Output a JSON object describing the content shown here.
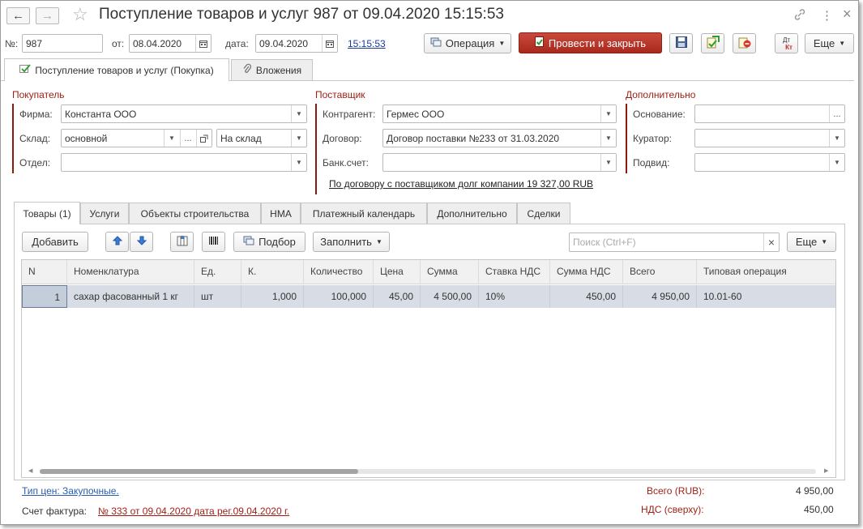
{
  "window": {
    "title": "Поступление товаров и услуг 987 от 09.04.2020 15:15:53",
    "back_glyph": "←",
    "forward_glyph": "→",
    "star_glyph": "☆",
    "link_glyph": "🔗",
    "menu_glyph": "⋮",
    "close_glyph": "×"
  },
  "header": {
    "number_label": "№:",
    "number_value": "987",
    "from_label": "от:",
    "from_value": "08.04.2020",
    "date_label": "дата:",
    "date_value": "09.04.2020",
    "time_link": "15:15:53",
    "operation_button": "Операция",
    "post_close_button": "Провести и закрыть",
    "more_button": "Еще",
    "dtkt_icon_text_top": "Дт",
    "dtkt_icon_text_bottom": "Кт"
  },
  "doc_tabs": [
    {
      "label": "Поступление товаров и услуг (Покупка)",
      "active": true
    },
    {
      "label": "Вложения",
      "active": false
    }
  ],
  "buyer": {
    "title": "Покупатель",
    "firm_label": "Фирма:",
    "firm_value": "Константа ООО",
    "warehouse_label": "Склад:",
    "warehouse_value": "основной",
    "warehouse_dots": "...",
    "destination_value": "На склад",
    "dept_label": "Отдел:",
    "dept_value": ""
  },
  "supplier": {
    "title": "Поставщик",
    "counterparty_label": "Контрагент:",
    "counterparty_value": "Гермес ООО",
    "contract_label": "Договор:",
    "contract_value": "Договор поставки №233 от 31.03.2020",
    "bank_label": "Банк.счет:",
    "bank_value": "",
    "debt_link": "По договору с поставщиком долг компании 19 327,00 RUB"
  },
  "additional": {
    "title": "Дополнительно",
    "basis_label": "Основание:",
    "basis_value": "",
    "basis_dots": "...",
    "curator_label": "Куратор:",
    "curator_value": "",
    "subtype_label": "Подвид:",
    "subtype_value": ""
  },
  "section_tabs": [
    {
      "label": "Товары (1)",
      "active": true
    },
    {
      "label": "Услуги",
      "active": false
    },
    {
      "label": "Объекты строительства",
      "active": false
    },
    {
      "label": "НМА",
      "active": false
    },
    {
      "label": "Платежный календарь",
      "active": false
    },
    {
      "label": "Дополнительно",
      "active": false
    },
    {
      "label": "Сделки",
      "active": false
    }
  ],
  "table_toolbar": {
    "add_button": "Добавить",
    "selection_button": "Подбор",
    "fill_button": "Заполнить",
    "search_placeholder": "Поиск (Ctrl+F)",
    "clear_glyph": "×",
    "more_button": "Еще"
  },
  "table": {
    "columns": [
      "N",
      "Номенклатура",
      "Ед.",
      "К.",
      "Количество",
      "Цена",
      "Сумма",
      "Ставка НДС",
      "Сумма НДС",
      "Всего",
      "Типовая операция"
    ],
    "rows": [
      {
        "n": "1",
        "item": "сахар фасованный 1 кг",
        "unit": "шт",
        "k": "1,000",
        "qty": "100,000",
        "price": "45,00",
        "sum": "4 500,00",
        "vat_rate": "10%",
        "vat_sum": "450,00",
        "total": "4 950,00",
        "operation": "10.01-60"
      }
    ]
  },
  "footer": {
    "price_type_link": "Тип цен: Закупочные.",
    "invoice_label": "Счет фактура:",
    "invoice_link": "№ 333 от 09.04.2020 дата рег.09.04.2020 г.",
    "total_label": "Всего (RUB):",
    "total_value": "4 950,00",
    "vat_label": "НДС (сверху):",
    "vat_value": "450,00"
  },
  "colors": {
    "accent_red": "#a9281d",
    "section_title": "#9e1d12",
    "link_blue": "#1c3a9c",
    "selected_row": "#d8dde5"
  }
}
